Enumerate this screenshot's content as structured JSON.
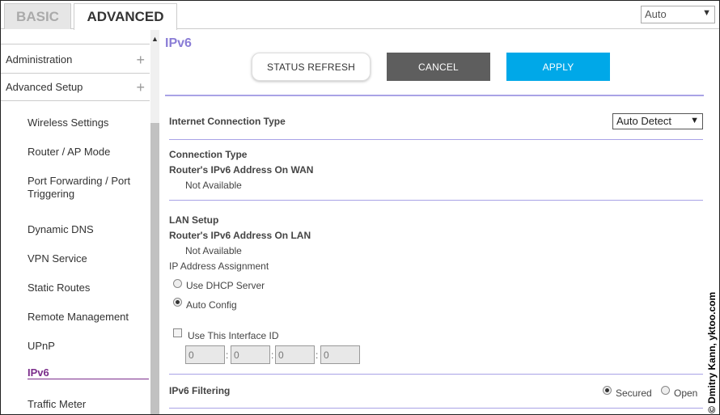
{
  "tabs": {
    "basic": "BASIC",
    "advanced": "ADVANCED"
  },
  "language": {
    "value": "Auto"
  },
  "sidebar": {
    "sections": [
      "Administration",
      "Advanced Setup"
    ],
    "items": [
      "Wireless Settings",
      "Router / AP Mode",
      "Port Forwarding / Port Triggering",
      "Dynamic DNS",
      "VPN Service",
      "Static Routes",
      "Remote Management",
      "UPnP",
      "IPv6",
      "Traffic Meter"
    ],
    "active": "IPv6"
  },
  "main": {
    "title": "IPv6",
    "buttons": {
      "refresh": "STATUS REFRESH",
      "cancel": "CANCEL",
      "apply": "APPLY"
    },
    "internet_connection_type": {
      "label": "Internet Connection Type",
      "value": "Auto Detect"
    },
    "connection": {
      "label": "Connection Type",
      "wan_label": "Router's IPv6 Address On WAN",
      "wan_value": "Not Available"
    },
    "lan": {
      "label": "LAN Setup",
      "lan_label": "Router's IPv6 Address On LAN",
      "lan_value": "Not Available",
      "assignment_label": "IP Address Assignment",
      "option_dhcp": "Use DHCP Server",
      "option_auto": "Auto Config",
      "selected": "Auto Config",
      "interface_id_label": "Use This Interface ID",
      "interface_id_checked": false,
      "interface_id": [
        "0",
        "0",
        "0",
        "0"
      ]
    },
    "filtering": {
      "label": "IPv6 Filtering",
      "option_secured": "Secured",
      "option_open": "Open",
      "selected": "Secured"
    }
  },
  "watermark": "© Dmitry Kann, yktoo.com",
  "colors": {
    "accent_purple": "#8a7dd6",
    "apply_blue": "#00a8e8",
    "cancel_gray": "#5e5e5e",
    "active_item": "#7b2d8b"
  }
}
